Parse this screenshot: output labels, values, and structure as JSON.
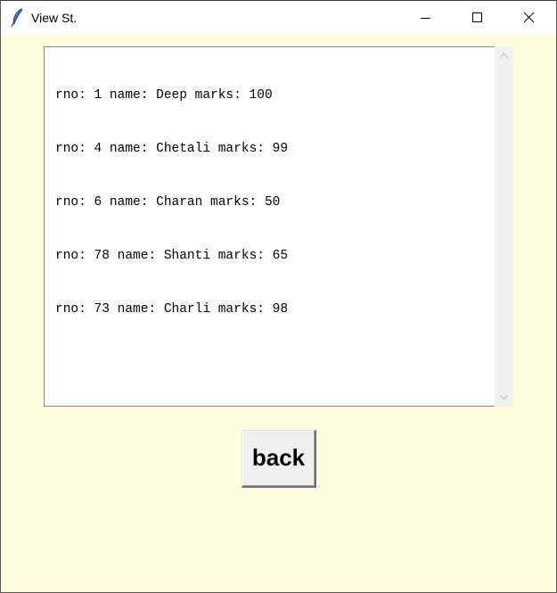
{
  "window": {
    "title": "View St.",
    "app_icon": "feather-icon",
    "controls": [
      "minimize-icon",
      "maximize-icon",
      "close-icon"
    ]
  },
  "listbox": {
    "lines": [
      "rno: 1 name: Deep marks: 100",
      "rno: 4 name: Chetali marks: 99",
      "rno: 6 name: Charan marks: 50",
      "rno: 78 name: Shanti marks: 65",
      "rno: 73 name: Charli marks: 98"
    ]
  },
  "buttons": {
    "back_label": "back"
  },
  "colors": {
    "window_background": "#fffddf",
    "titlebar_background": "#ffffff",
    "listbox_background": "#ffffff",
    "scrollbar_track": "#f0f0f0",
    "button_face": "#f0f0f0"
  }
}
